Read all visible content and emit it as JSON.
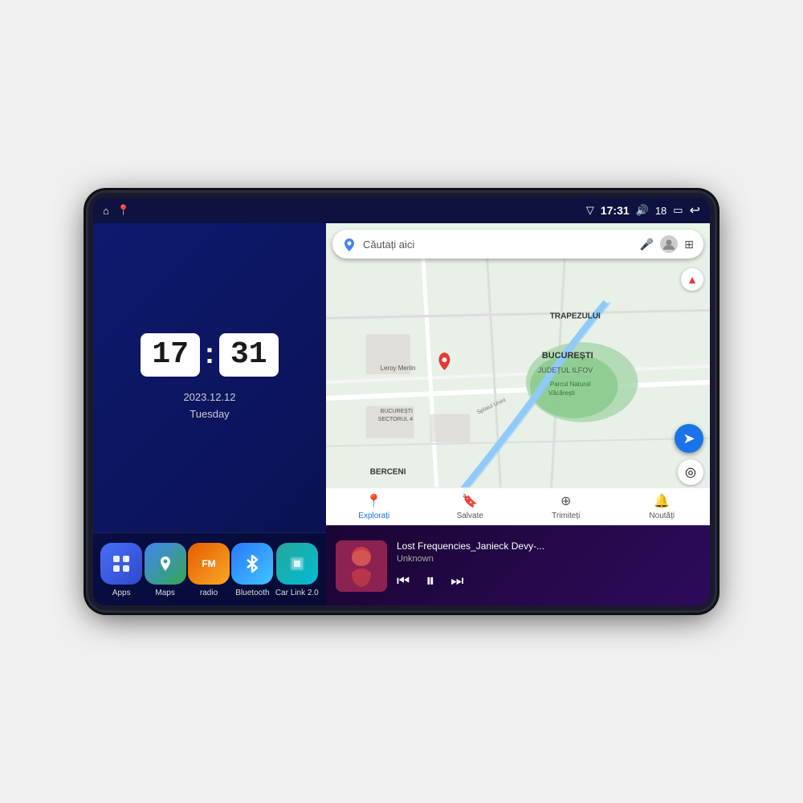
{
  "device": {
    "statusBar": {
      "signal_icon": "▽",
      "time": "17:31",
      "volume_icon": "🔊",
      "volume_level": "18",
      "battery_icon": "▭",
      "back_icon": "↩"
    },
    "home_icon": "⌂",
    "maps_icon": "📍"
  },
  "clock": {
    "hours": "17",
    "minutes": "31",
    "date": "2023.12.12",
    "weekday": "Tuesday"
  },
  "apps": [
    {
      "id": "apps",
      "label": "Apps",
      "icon": "⊞",
      "color_class": "apps-icon"
    },
    {
      "id": "maps",
      "label": "Maps",
      "icon": "🗺",
      "color_class": "maps-icon"
    },
    {
      "id": "radio",
      "label": "radio",
      "icon": "📻",
      "color_class": "radio-icon"
    },
    {
      "id": "bluetooth",
      "label": "Bluetooth",
      "icon": "🔷",
      "color_class": "bluetooth-icon"
    },
    {
      "id": "carlink",
      "label": "Car Link 2.0",
      "icon": "📱",
      "color_class": "carlink-icon"
    }
  ],
  "map": {
    "searchPlaceholder": "Căutați aici",
    "navItems": [
      {
        "id": "explore",
        "label": "Explorați",
        "icon": "📍",
        "active": true
      },
      {
        "id": "saved",
        "label": "Salvate",
        "icon": "🔖",
        "active": false
      },
      {
        "id": "contribute",
        "label": "Trimiteți",
        "icon": "➕",
        "active": false
      },
      {
        "id": "news",
        "label": "Noutăți",
        "icon": "🔔",
        "active": false
      }
    ],
    "labels": [
      "TRAPEZULUI",
      "BUCUREȘTI",
      "JUDEȚUL ILFOV",
      "BERCENI",
      "Leroy Merlin",
      "Parcul Natural Văcărești",
      "BUCUREȘTI SECTORUL 4",
      "Splaiul Unirii"
    ]
  },
  "music": {
    "title": "Lost Frequencies_Janieck Devy-...",
    "artist": "Unknown",
    "prev_label": "⏮",
    "play_label": "⏸",
    "next_label": "⏭"
  }
}
